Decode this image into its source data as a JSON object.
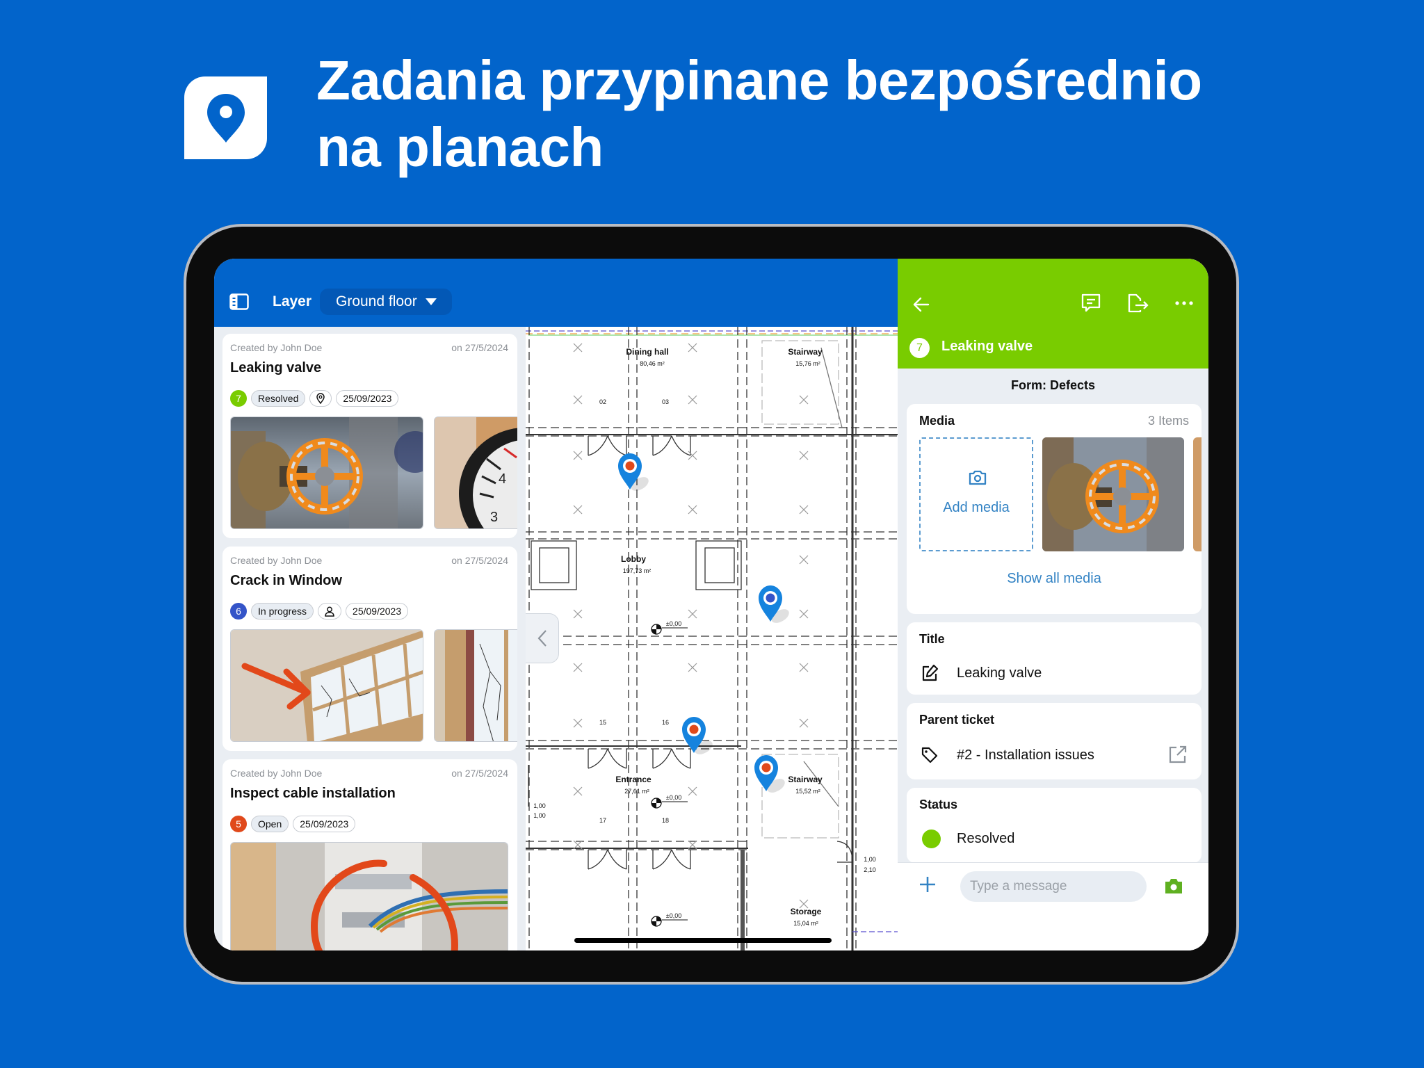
{
  "hero": {
    "title_line1": "Zadania przypinane bezpośrednio",
    "title_line2": "na planach",
    "logo_icon": "map-pin-icon"
  },
  "colors": {
    "brand_blue": "#0264cb",
    "resolved_green": "#79cc00",
    "in_progress_blue": "#3454c8",
    "open_orange": "#e0491b",
    "link_blue": "#3383c4"
  },
  "toolbar": {
    "sidebar_icon": "sidebar-toggle-icon",
    "layer_label": "Layer",
    "layer_value": "Ground floor"
  },
  "tasks": [
    {
      "created_by": "Created by John Doe",
      "created_on": "on 27/5/2024",
      "title": "Leaking valve",
      "number": "7",
      "status": "Resolved",
      "extra_icon": "map-pin-icon",
      "due_date": "25/09/2023",
      "images": [
        "orange valve wheel",
        "thermostat radiator knob"
      ]
    },
    {
      "created_by": "Created by John Doe",
      "created_on": "on 27/5/2024",
      "title": "Crack in Window",
      "number": "6",
      "status": "In progress",
      "extra_icon": "user-icon",
      "due_date": "25/09/2023",
      "images": [
        "cracked window with arrow",
        "cracked window close-up"
      ]
    },
    {
      "created_by": "Created by John Doe",
      "created_on": "on 27/5/2024",
      "title": "Inspect cable installation",
      "number": "5",
      "status": "Open",
      "due_date": "25/09/2023",
      "images": [
        "electrical panel with cables circled"
      ]
    }
  ],
  "plan": {
    "rooms": [
      {
        "name": "Dining hall",
        "area": "80,46 m²"
      },
      {
        "name": "Stairway",
        "area": "15,76 m²"
      },
      {
        "name": "Lobby",
        "area": "197,73 m²"
      },
      {
        "name": "Entrance",
        "area": "27,61 m²"
      },
      {
        "name": "Stairway",
        "area": "15,52 m²"
      },
      {
        "name": "Storage",
        "area": "15,04 m²"
      }
    ],
    "labels": {
      "door_02": "02",
      "door_03": "03",
      "door_15": "15",
      "door_16": "16",
      "door_17": "17",
      "door_18": "18",
      "level": "±0,00",
      "dim_a_top": "1,00",
      "dim_a_bottom": "1,00",
      "dim_b_top": "1,00",
      "dim_b_bottom": "2,10"
    },
    "pins": [
      {
        "status": "open",
        "color": "#e0491b"
      },
      {
        "status": "in progress",
        "color": "#3454c8"
      },
      {
        "status": "open",
        "color": "#e0491b"
      },
      {
        "status": "open",
        "color": "#e0491b"
      }
    ]
  },
  "detail": {
    "number": "7",
    "title": "Leaking valve",
    "form_label": "Form: Defects",
    "media": {
      "label": "Media",
      "count": "3 Items",
      "add_label": "Add media",
      "show_all": "Show all media"
    },
    "title_field": {
      "label": "Title",
      "value": "Leaking valve"
    },
    "parent_ticket": {
      "label": "Parent ticket",
      "value": "#2 - Installation issues"
    },
    "status": {
      "label": "Status",
      "value": "Resolved"
    },
    "composer": {
      "placeholder": "Type a message"
    }
  }
}
